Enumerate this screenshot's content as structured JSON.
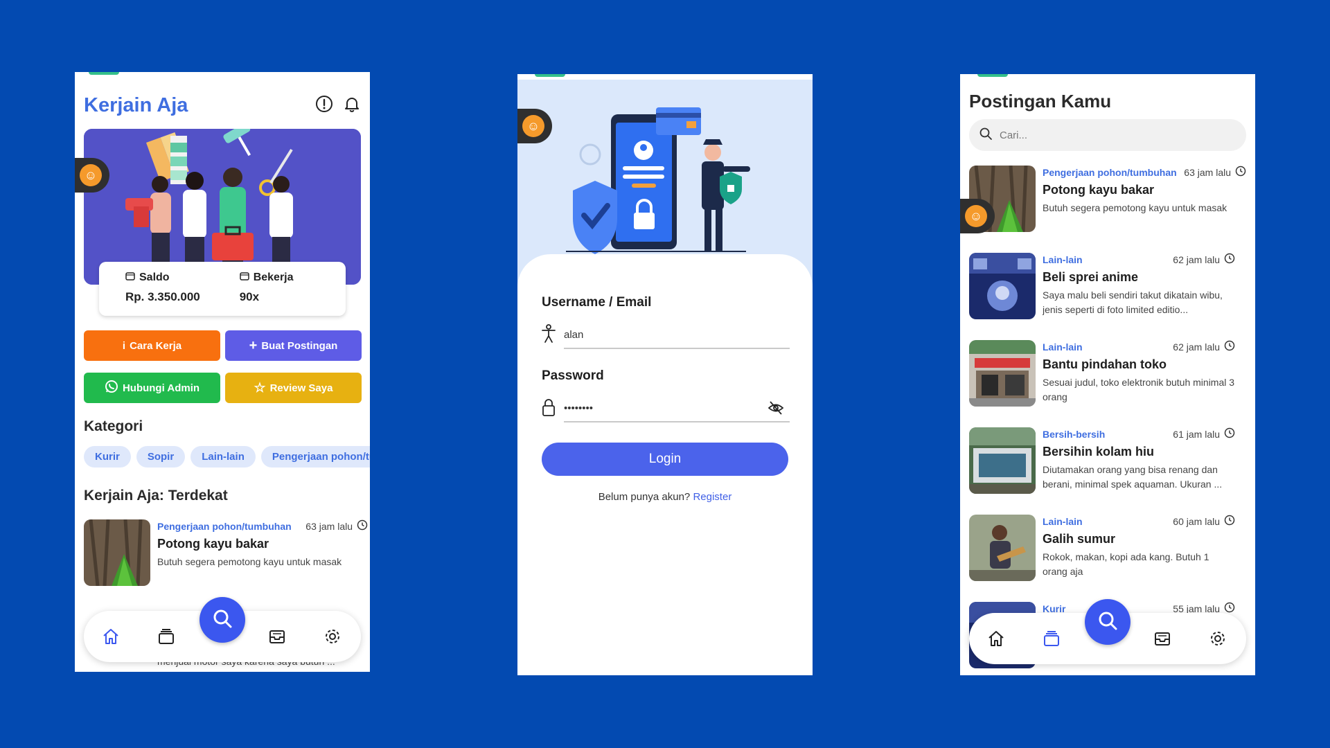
{
  "colors": {
    "background": "#034ab1",
    "primary": "#3f6ee0",
    "cara_kerja": "#f8700f",
    "buat_postingan": "#5e5ce6",
    "hubungi_admin": "#21ba4d",
    "review_saya": "#e7b111",
    "login": "#4b63eb",
    "fab": "#3b57ef"
  },
  "home": {
    "title": "Kerjain Aja",
    "balance": {
      "saldo_label": "Saldo",
      "saldo_value": "Rp. 3.350.000",
      "bekerja_label": "Bekerja",
      "bekerja_value": "90x"
    },
    "buttons": {
      "cara_kerja": "Cara Kerja",
      "buat_postingan": "Buat Postingan",
      "hubungi_admin": "Hubungi Admin",
      "review_saya": "Review Saya"
    },
    "kategori_title": "Kategori",
    "categories": [
      "Kurir",
      "Sopir",
      "Lain-lain",
      "Pengerjaan pohon/tumbuhan"
    ],
    "terdekat_title": "Kerjain Aja: Terdekat",
    "posts": [
      {
        "category": "Pengerjaan pohon/tumbuhan",
        "time": "63 jam lalu",
        "title": "Potong kayu bakar",
        "desc": "Butuh segera pemotong kayu untuk masak"
      }
    ],
    "partial_text": "menjual motor saya karena saya butuh ..."
  },
  "login": {
    "username_label": "Username / Email",
    "username_value": "alan",
    "password_label": "Password",
    "password_value": "••••••••",
    "login_button": "Login",
    "no_account": "Belum punya akun? ",
    "register": "Register"
  },
  "posts_page": {
    "title": "Postingan Kamu",
    "search_placeholder": "Cari...",
    "posts": [
      {
        "category": "Pengerjaan pohon/tumbuhan",
        "time": "63 jam lalu",
        "title": "Potong kayu bakar",
        "desc": "Butuh segera pemotong kayu untuk masak"
      },
      {
        "category": "Lain-lain",
        "time": "62 jam lalu",
        "title": "Beli sprei anime",
        "desc": "Saya malu beli sendiri takut dikatain wibu, jenis seperti di foto limited editio..."
      },
      {
        "category": "Lain-lain",
        "time": "62 jam lalu",
        "title": "Bantu pindahan toko",
        "desc": "Sesuai judul, toko elektronik butuh minimal 3 orang"
      },
      {
        "category": "Bersih-bersih",
        "time": "61 jam lalu",
        "title": "Bersihin kolam hiu",
        "desc": "Diutamakan orang yang bisa renang dan berani, minimal spek aquaman. Ukuran ..."
      },
      {
        "category": "Lain-lain",
        "time": "60 jam lalu",
        "title": "Galih sumur",
        "desc": "Rokok, makan, kopi ada kang. Butuh 1 orang aja"
      },
      {
        "category": "Kurir",
        "time": "55 jam lalu",
        "title": "",
        "desc": ""
      }
    ]
  }
}
